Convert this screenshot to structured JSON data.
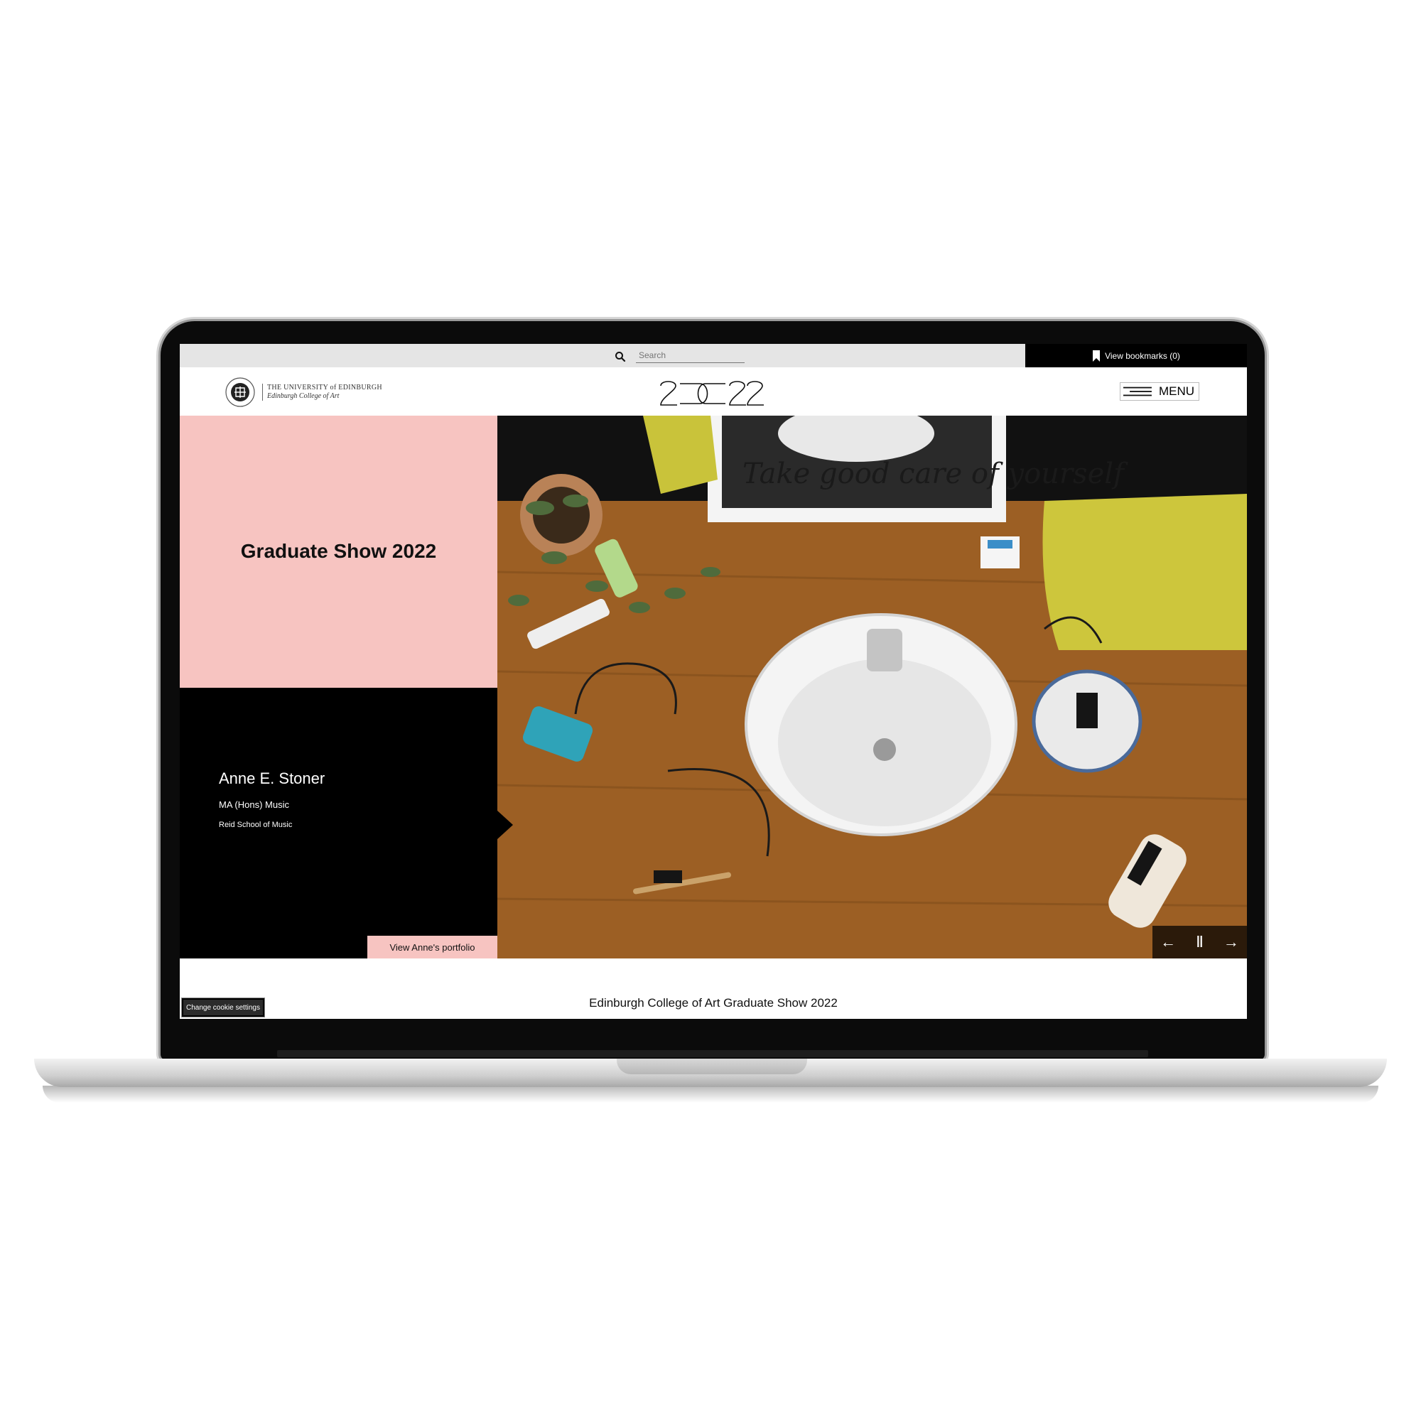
{
  "topbar": {
    "search_placeholder": "Search",
    "bookmarks_label": "View bookmarks (0)"
  },
  "header": {
    "university_line1": "THE UNIVERSITY of EDINBURGH",
    "university_line2": "Edinburgh College of Art",
    "year_logo": "2022",
    "menu_label": "MENU"
  },
  "hero": {
    "show_title": "Graduate Show 2022",
    "student_name": "Anne E. Stoner",
    "degree": "MA (Hons) Music",
    "school": "Reid School of Music",
    "portfolio_button": "View Anne's portfolio",
    "photo_alt": "Take good care of yourself",
    "controls": {
      "prev": "←",
      "pause": "Ⅱ",
      "next": "→"
    }
  },
  "footer": {
    "title": "Edinburgh College of Art Graduate Show 2022",
    "cookie_button": "Change cookie settings"
  },
  "colors": {
    "pink": "#f7c4c1",
    "black": "#000000",
    "topbar": "#e5e5e5"
  }
}
